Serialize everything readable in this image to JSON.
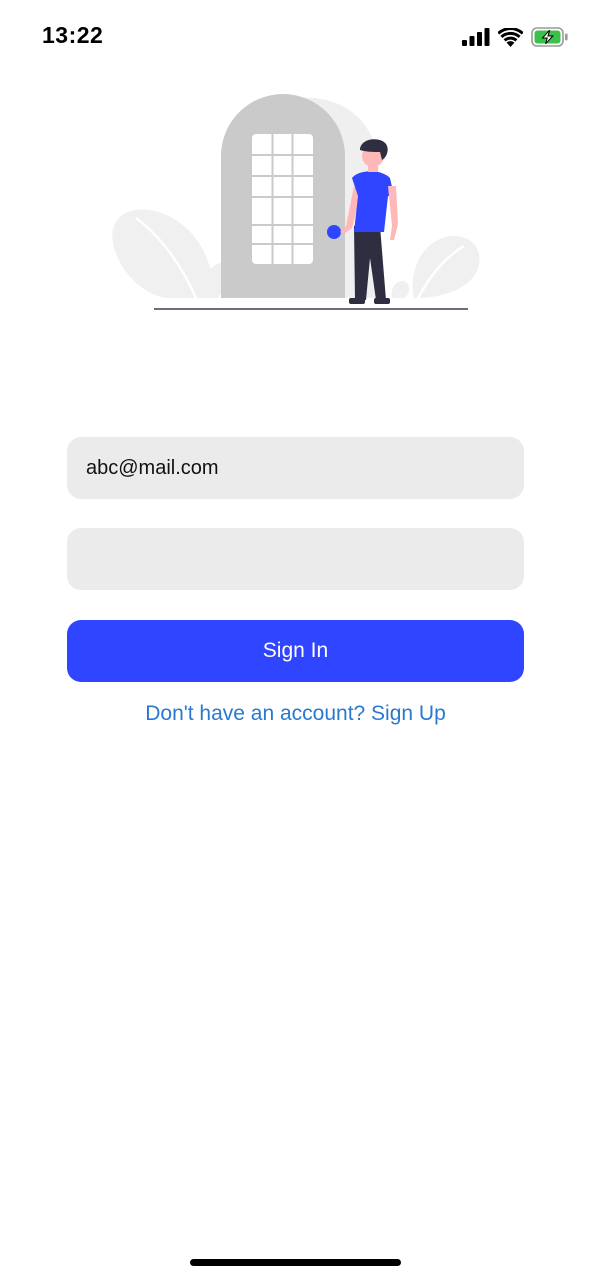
{
  "status_bar": {
    "time": "13:22",
    "icons": [
      "cellular-signal-icon",
      "wifi-icon",
      "battery-charging-icon"
    ]
  },
  "login_form": {
    "email": {
      "value": "abc@mail.com",
      "placeholder": ""
    },
    "password": {
      "value": "",
      "placeholder": ""
    },
    "sign_in_label": "Sign In",
    "signup_link_label": "Don't have an account? Sign Up"
  },
  "colors": {
    "accent": "#2f45ff",
    "field_background": "#ebebeb",
    "link": "#2979d0",
    "battery": "#3ac14a"
  }
}
